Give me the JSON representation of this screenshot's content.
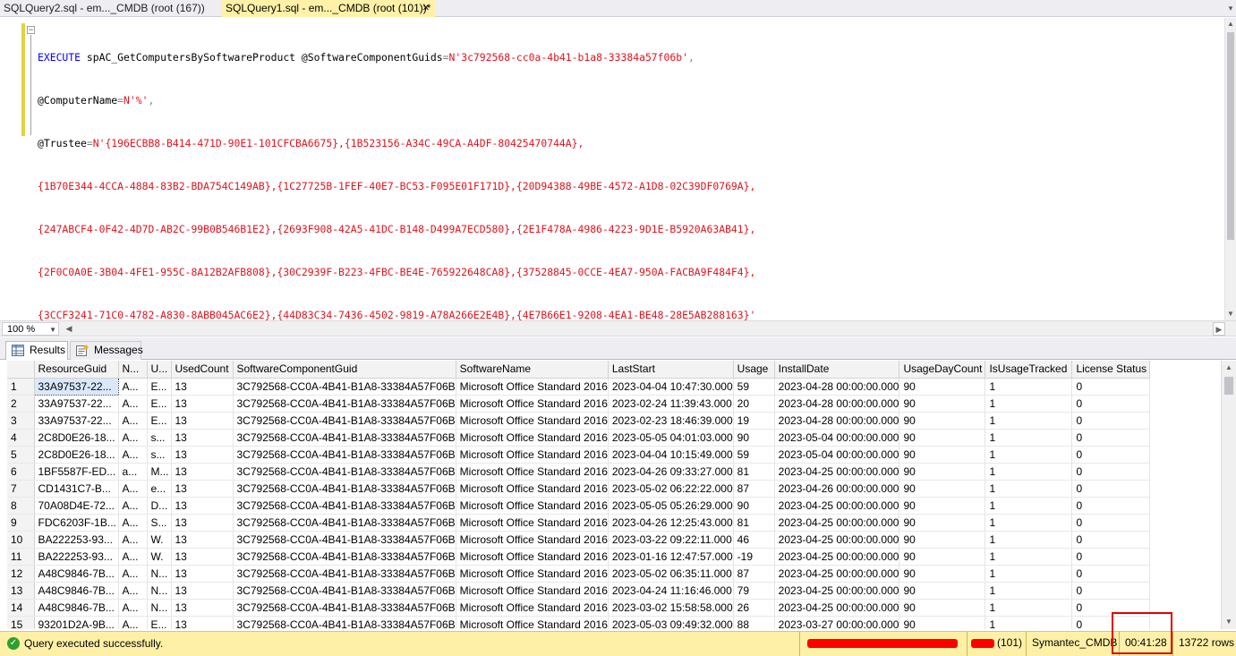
{
  "tabs": [
    {
      "label": "SQLQuery2.sql - em..._CMDB (root (167))",
      "close": ""
    },
    {
      "label": "SQLQuery1.sql - em..._CMDB (root (101))*",
      "close": "✕"
    }
  ],
  "editor": {
    "l1_kw": "EXECUTE",
    "l1_proc": " spAC_GetComputersBySoftwareProduct ",
    "l1_param": "@SoftwareComponentGuids",
    "l1_eq": "=",
    "l1_val": "N'3c792568-cc0a-4b41-b1a8-33384a57f06b'",
    "l1_end": ",",
    "l2_param": "@ComputerName",
    "l2_eq": "=",
    "l2_val": "N'%'",
    "l2_end": ",",
    "l3_param": "@Trustee",
    "l3_eq": "=",
    "l3_val": "N'{196ECBB8-B414-471D-90E1-101CFCBA6675},{1B523156-A34C-49CA-A4DF-80425470744A},",
    "l4": "{1B70E344-4CCA-4884-83B2-BDA754C149AB},{1C27725B-1FEF-40E7-BC53-F095E01F171D},{20D94388-49BE-4572-A1D8-02C39DF0769A},",
    "l5": "{247ABCF4-0F42-4D7D-AB2C-99B0B546B1E2},{2693F908-42A5-41DC-B148-D499A7ECD580},{2E1F478A-4986-4223-9D1E-B5920A63AB41},",
    "l6": "{2F0C0A0E-3B04-4FE1-955C-8A12B2AFB808},{30C2939F-B223-4FBC-BE4E-765922648CA8},{37528845-0CCE-4EA7-950A-FACBA9F484F4},",
    "l7": "{3CCF3241-71C0-4782-A830-8ABB045AC6E2},{44D83C34-7436-4502-9819-A78A266E2E4B},{4E7B66E1-9208-4EA1-BE48-28E5AB288163}'"
  },
  "zoom": "100 %",
  "result_tabs": {
    "results": "Results",
    "messages": "Messages"
  },
  "grid": {
    "columns": [
      "",
      "ResourceGuid",
      "N...",
      "U...",
      "UsedCount",
      "SoftwareComponentGuid",
      "SoftwareName",
      "LastStart",
      "Usage",
      "InstallDate",
      "UsageDayCount",
      "IsUsageTracked",
      "License Status"
    ],
    "rows": [
      [
        "1",
        "33A97537-22...",
        "A...",
        "E...",
        "13",
        "3C792568-CC0A-4B41-B1A8-33384A57F06B",
        "Microsoft Office Standard 2016",
        "2023-04-04 10:47:30.000",
        "59",
        "2023-04-28 00:00:00.000",
        "90",
        "1",
        "0"
      ],
      [
        "2",
        "33A97537-22...",
        "A...",
        "E...",
        "13",
        "3C792568-CC0A-4B41-B1A8-33384A57F06B",
        "Microsoft Office Standard 2016",
        "2023-02-24 11:39:43.000",
        "20",
        "2023-04-28 00:00:00.000",
        "90",
        "1",
        "0"
      ],
      [
        "3",
        "33A97537-22...",
        "A...",
        "E...",
        "13",
        "3C792568-CC0A-4B41-B1A8-33384A57F06B",
        "Microsoft Office Standard 2016",
        "2023-02-23 18:46:39.000",
        "19",
        "2023-04-28 00:00:00.000",
        "90",
        "1",
        "0"
      ],
      [
        "4",
        "2C8D0E26-18...",
        "A...",
        "s...",
        "13",
        "3C792568-CC0A-4B41-B1A8-33384A57F06B",
        "Microsoft Office Standard 2016",
        "2023-05-05 04:01:03.000",
        "90",
        "2023-05-04 00:00:00.000",
        "90",
        "1",
        "0"
      ],
      [
        "5",
        "2C8D0E26-18...",
        "A...",
        "s...",
        "13",
        "3C792568-CC0A-4B41-B1A8-33384A57F06B",
        "Microsoft Office Standard 2016",
        "2023-04-04 10:15:49.000",
        "59",
        "2023-05-04 00:00:00.000",
        "90",
        "1",
        "0"
      ],
      [
        "6",
        "1BF5587F-ED...",
        "a...",
        "M...",
        "13",
        "3C792568-CC0A-4B41-B1A8-33384A57F06B",
        "Microsoft Office Standard 2016",
        "2023-04-26 09:33:27.000",
        "81",
        "2023-04-25 00:00:00.000",
        "90",
        "1",
        "0"
      ],
      [
        "7",
        "CD1431C7-B...",
        "A...",
        "e...",
        "13",
        "3C792568-CC0A-4B41-B1A8-33384A57F06B",
        "Microsoft Office Standard 2016",
        "2023-05-02 06:22:22.000",
        "87",
        "2023-04-26 00:00:00.000",
        "90",
        "1",
        "0"
      ],
      [
        "8",
        "70A08D4E-72...",
        "A...",
        "D...",
        "13",
        "3C792568-CC0A-4B41-B1A8-33384A57F06B",
        "Microsoft Office Standard 2016",
        "2023-05-05 05:26:29.000",
        "90",
        "2023-04-25 00:00:00.000",
        "90",
        "1",
        "0"
      ],
      [
        "9",
        "FDC6203F-1B...",
        "A...",
        "S...",
        "13",
        "3C792568-CC0A-4B41-B1A8-33384A57F06B",
        "Microsoft Office Standard 2016",
        "2023-04-26 12:25:43.000",
        "81",
        "2023-04-25 00:00:00.000",
        "90",
        "1",
        "0"
      ],
      [
        "10",
        "BA222253-93...",
        "A...",
        "W.",
        "13",
        "3C792568-CC0A-4B41-B1A8-33384A57F06B",
        "Microsoft Office Standard 2016",
        "2023-03-22 09:22:11.000",
        "46",
        "2023-04-25 00:00:00.000",
        "90",
        "1",
        "0"
      ],
      [
        "11",
        "BA222253-93...",
        "A...",
        "W.",
        "13",
        "3C792568-CC0A-4B41-B1A8-33384A57F06B",
        "Microsoft Office Standard 2016",
        "2023-01-16 12:47:57.000",
        "-19",
        "2023-04-25 00:00:00.000",
        "90",
        "1",
        "0"
      ],
      [
        "12",
        "A48C9846-7B...",
        "A...",
        "N...",
        "13",
        "3C792568-CC0A-4B41-B1A8-33384A57F06B",
        "Microsoft Office Standard 2016",
        "2023-05-02 06:35:11.000",
        "87",
        "2023-04-25 00:00:00.000",
        "90",
        "1",
        "0"
      ],
      [
        "13",
        "A48C9846-7B...",
        "A...",
        "N...",
        "13",
        "3C792568-CC0A-4B41-B1A8-33384A57F06B",
        "Microsoft Office Standard 2016",
        "2023-04-24 11:16:46.000",
        "79",
        "2023-04-25 00:00:00.000",
        "90",
        "1",
        "0"
      ],
      [
        "14",
        "A48C9846-7B...",
        "A...",
        "N...",
        "13",
        "3C792568-CC0A-4B41-B1A8-33384A57F06B",
        "Microsoft Office Standard 2016",
        "2023-03-02 15:58:58.000",
        "26",
        "2023-04-25 00:00:00.000",
        "90",
        "1",
        "0"
      ],
      [
        "15",
        "93201D2A-9B...",
        "A...",
        "E...",
        "13",
        "3C792568-CC0A-4B41-B1A8-33384A57F06B",
        "Microsoft Office Standard 2016",
        "2023-05-03 09:49:32.000",
        "88",
        "2023-03-27 00:00:00.000",
        "90",
        "1",
        "0"
      ]
    ]
  },
  "status": {
    "message": "Query executed successfully.",
    "server": "",
    "user": "(101)",
    "database": "Symantec_CMDB",
    "elapsed": "00:41:28",
    "rows": "13722 rows"
  },
  "colors": {
    "keyword": "#0000ff",
    "string": "#e0141e",
    "status_bg": "#fff0a8",
    "active_tab": "#fff1a8",
    "highlight": "#e00000"
  },
  "icons": {
    "status": "check-circle-icon",
    "results": "grid-icon",
    "messages": "message-icon"
  }
}
